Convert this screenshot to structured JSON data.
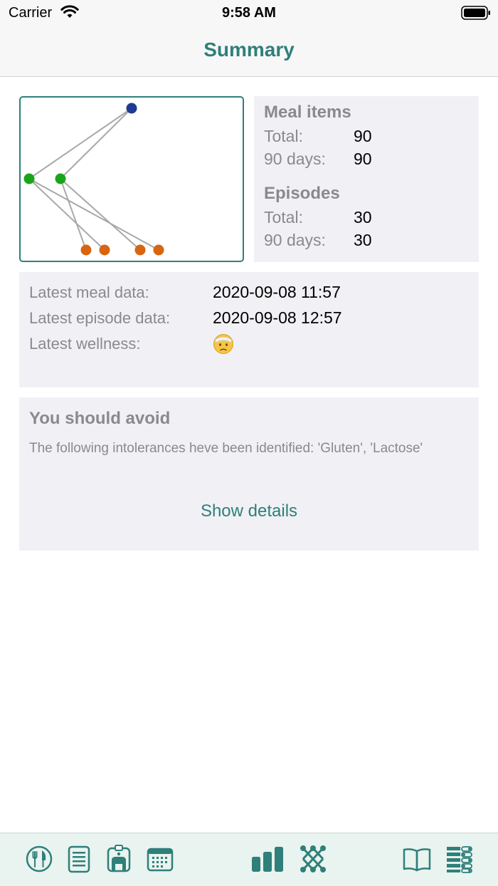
{
  "status_bar": {
    "carrier": "Carrier",
    "time": "9:58 AM"
  },
  "nav": {
    "title": "Summary"
  },
  "stats": {
    "meal_items": {
      "heading": "Meal items",
      "total_label": "Total:",
      "total_value": "90",
      "days_label": "90 days:",
      "days_value": "90"
    },
    "episodes": {
      "heading": "Episodes",
      "total_label": "Total:",
      "total_value": "30",
      "days_label": "90 days:",
      "days_value": "30"
    }
  },
  "latest": {
    "meal_label": "Latest meal data:",
    "meal_value": "2020-09-08 11:57",
    "episode_label": "Latest episode data:",
    "episode_value": "2020-09-08 12:57",
    "wellness_label": "Latest wellness:",
    "wellness_icon": "injured-face-emoji"
  },
  "avoid": {
    "title": "You should avoid",
    "text": "The following intolerances heve been identified: 'Gluten', 'Lactose'",
    "button": "Show details"
  },
  "graph": {
    "node_colors": {
      "top": "#1f3a93",
      "middle": "#19a519",
      "bottom": "#d8650f"
    }
  },
  "tabbar": {
    "tabs": [
      {
        "icon": "meal-plate-icon"
      },
      {
        "icon": "list-icon"
      },
      {
        "icon": "toilet-icon"
      },
      {
        "icon": "calendar-icon"
      },
      {
        "icon": "bar-chart-icon"
      },
      {
        "icon": "network-icon"
      },
      {
        "icon": "book-icon"
      },
      {
        "icon": "settings-list-icon"
      }
    ]
  },
  "colors": {
    "accent": "#2f7f7a",
    "card_background": "#f1f1f5",
    "muted_text": "#8a8a8e"
  }
}
